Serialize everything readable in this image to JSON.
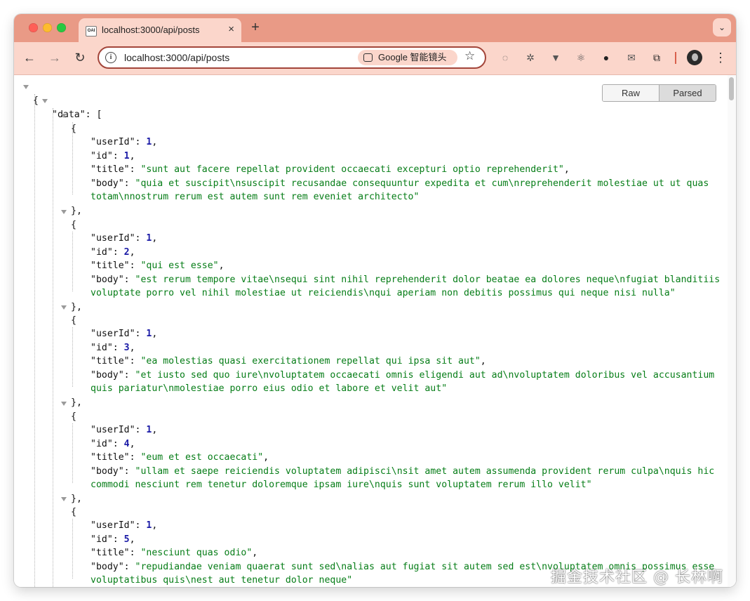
{
  "browser": {
    "tab_title": "localhost:3000/api/posts",
    "tab_favicon_text": "OAI",
    "tab_close": "×",
    "new_tab": "+",
    "tab_menu": "⌄",
    "address": "localhost:3000/api/posts",
    "lens_label": "Google 智能镜头",
    "back": "←",
    "forward": "→",
    "reload": "↻",
    "star": "☆",
    "menu": "⋮",
    "extension_icons": [
      "circle-dots-icon",
      "gear-icon",
      "vue-icon",
      "react-icon",
      "bear-icon",
      "mail-icon",
      "puzzle-icon"
    ]
  },
  "viewer": {
    "raw_label": "Raw",
    "parsed_label": "Parsed",
    "open_brace": "{",
    "data_key": "\"data\"",
    "colon_bracket": ": [",
    "posts": [
      {
        "userId": "1",
        "id": "1",
        "title": "\"sunt aut facere repellat provident occaecati excepturi optio reprehenderit\"",
        "body_1": "\"quia et suscipit\\nsuscipit recusandae consequuntur expedita et cum\\nreprehenderit molestiae ut ut quas",
        "body_2": "totam\\nnostrum rerum est autem sunt rem eveniet architecto\""
      },
      {
        "userId": "1",
        "id": "2",
        "title": "\"qui est esse\"",
        "body_1": "\"est rerum tempore vitae\\nsequi sint nihil reprehenderit dolor beatae ea dolores neque\\nfugiat blanditiis",
        "body_2": "voluptate porro vel nihil molestiae ut reiciendis\\nqui aperiam non debitis possimus qui neque nisi nulla\""
      },
      {
        "userId": "1",
        "id": "3",
        "title": "\"ea molestias quasi exercitationem repellat qui ipsa sit aut\"",
        "body_1": "\"et iusto sed quo iure\\nvoluptatem occaecati omnis eligendi aut ad\\nvoluptatem doloribus vel accusantium",
        "body_2": "quis pariatur\\nmolestiae porro eius odio et labore et velit aut\""
      },
      {
        "userId": "1",
        "id": "4",
        "title": "\"eum et est occaecati\"",
        "body_1": "\"ullam et saepe reiciendis voluptatem adipisci\\nsit amet autem assumenda provident rerum culpa\\nquis hic",
        "body_2": "commodi nesciunt rem tenetur doloremque ipsam iure\\nquis sunt voluptatem rerum illo velit\""
      },
      {
        "userId": "1",
        "id": "5",
        "title": "\"nesciunt quas odio\"",
        "body_1": "\"repudiandae veniam quaerat sunt sed\\nalias aut fugiat sit autem sed est\\nvoluptatem omnis possimus esse",
        "body_2": "voluptatibus quis\\nest aut tenetur dolor neque\""
      }
    ]
  },
  "watermark": "掘金技术社区 @ 长林啊"
}
